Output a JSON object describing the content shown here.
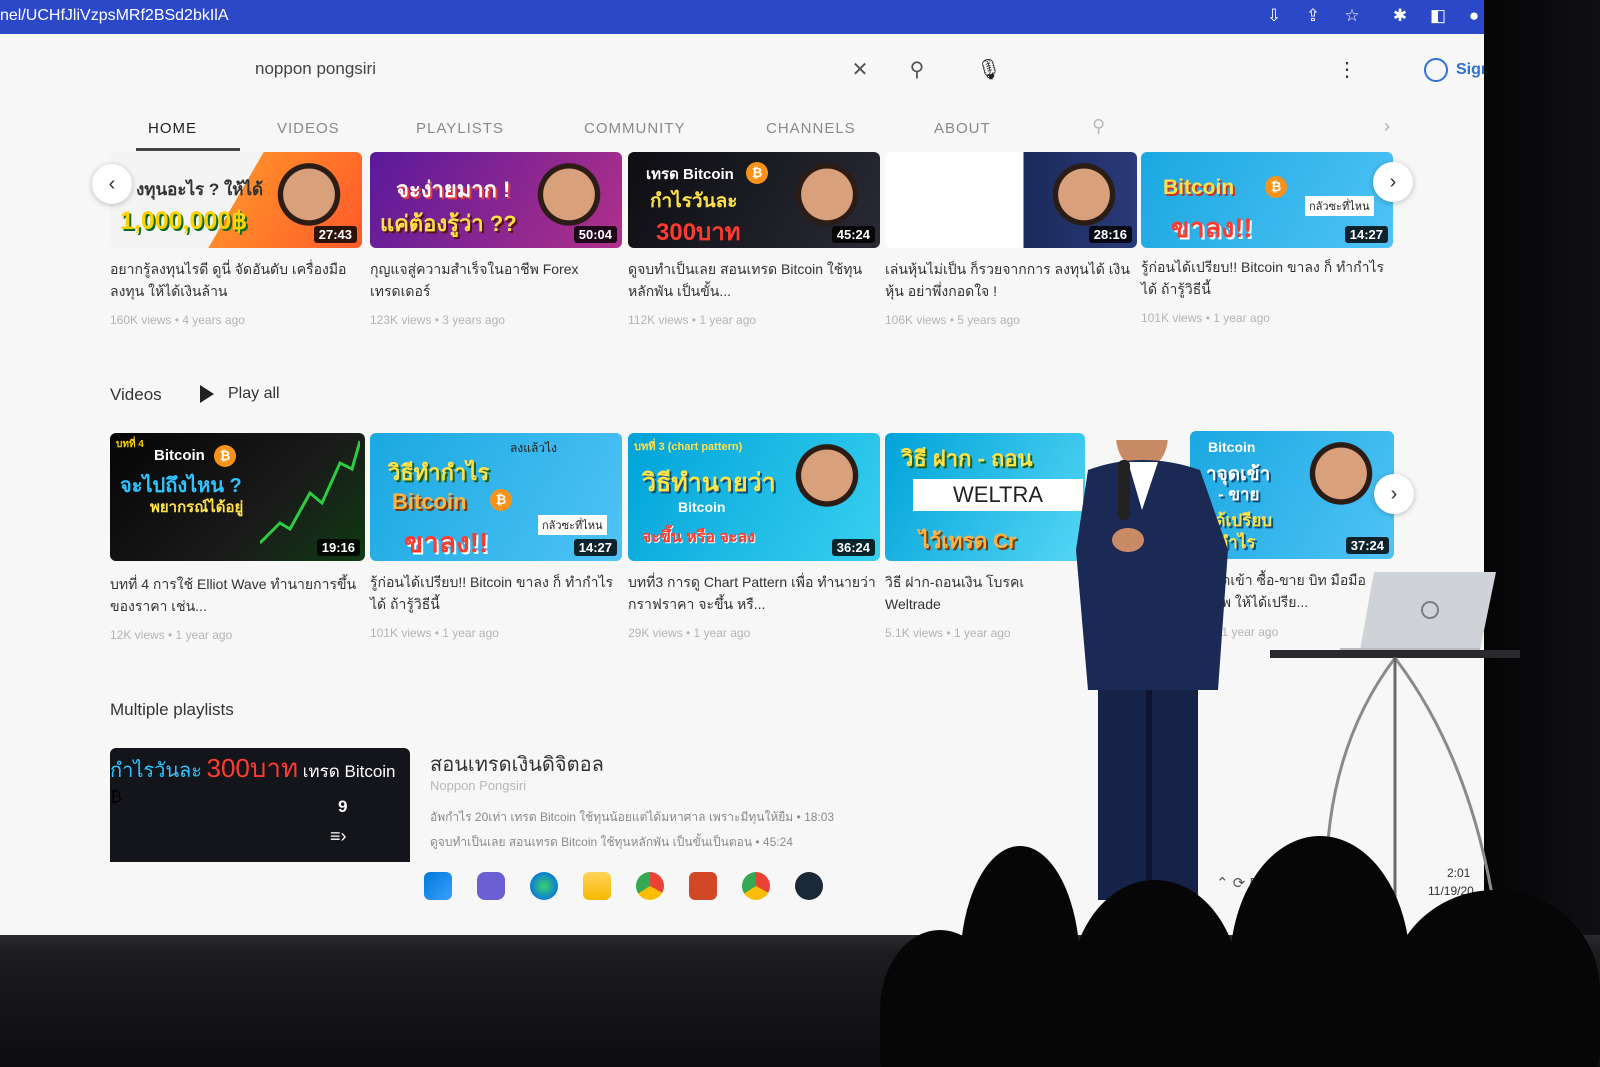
{
  "browser": {
    "url_fragment": "nel/UCHfJliVzpsMRf2BSd2bkIlA",
    "icons": [
      "install-icon",
      "share-icon",
      "star-icon",
      "extensions-icon",
      "window-icon",
      "profile-icon"
    ]
  },
  "channel_header": {
    "search_query": "noppon pongsiri",
    "sign_in_label": "Sign in"
  },
  "tabs": [
    {
      "label": "HOME",
      "active": true
    },
    {
      "label": "VIDEOS"
    },
    {
      "label": "PLAYLISTS"
    },
    {
      "label": "COMMUNITY"
    },
    {
      "label": "CHANNELS"
    },
    {
      "label": "ABOUT"
    }
  ],
  "row1": [
    {
      "thumb_line1": "งทุนอะไร ? ให้ได้",
      "thumb_line2": "1,000,000฿",
      "duration": "27:43",
      "title": "อยากรู้ลงทุนไรดี ดูนี่ จัดอันดับ เครื่องมือลงทุน ให้ได้เงินล้าน",
      "meta": "160K views • 4 years ago"
    },
    {
      "thumb_line1": "จะง่ายมาก !",
      "thumb_line2": "แค่ต้องรู้ว่า ??",
      "duration": "50:04",
      "title": "กุญแจสู่ความสำเร็จในอาชีพ Forex เทรดเดอร์",
      "meta": "123K views • 3 years ago"
    },
    {
      "thumb_line1": "เทรด Bitcoin",
      "thumb_line2": "กำไรวันละ",
      "thumb_line3": "300บาท",
      "duration": "45:24",
      "title": "ดูจบทำเป็นเลย สอนเทรด Bitcoin ใช้ทุนหลักพัน เป็นขั้น...",
      "meta": "112K views • 1 year ago"
    },
    {
      "duration": "28:16",
      "title": "เล่นหุ้นไม่เป็น ก็รวยจากการ ลงทุนได้ เงินหุ้น อย่าพึ่งกอดใจ !",
      "meta": "106K views • 5 years ago"
    },
    {
      "thumb_line1": "Bitcoin",
      "thumb_line2": "ขาลง!!",
      "thumb_tag": "กลัวซะที่ไหน",
      "duration": "14:27",
      "title": "รู้ก่อนได้เปรียบ!! Bitcoin ขาลง ก็ ทำกำไรได้ ถ้ารู้วิธีนี้",
      "meta": "101K views • 1 year ago"
    }
  ],
  "videos_section": {
    "title": "Videos",
    "play_all": "Play all"
  },
  "row2": [
    {
      "thumb_tag": "บทที่ 4",
      "thumb_line1": "Bitcoin",
      "thumb_line2": "จะไปถึงไหน ?",
      "thumb_line3": "พยากรณ์ได้อยู่",
      "duration": "19:16",
      "title": "บทที่ 4 การใช้ Elliot Wave ทำนายการขึ้นของราคา เช่น...",
      "meta": "12K views • 1 year ago"
    },
    {
      "thumb_tag": "ลงแล้วไง",
      "thumb_line1": "วิธีทำกำไร",
      "thumb_line2": "Bitcoin",
      "thumb_line3": "ขาลง!!",
      "thumb_tag2": "กลัวซะที่ไหน",
      "duration": "14:27",
      "title": "รู้ก่อนได้เปรียบ!! Bitcoin ขาลง ก็ ทำกำไรได้ ถ้ารู้วิธีนี้",
      "meta": "101K views • 1 year ago"
    },
    {
      "thumb_tag": "บทที่ 3 (chart pattern)",
      "thumb_line1": "วิธีทำนายว่า",
      "thumb_line2": "Bitcoin",
      "thumb_line3": "จะขึ้น หรือ จะลง",
      "duration": "36:24",
      "title": "บทที่3 การดู Chart Pattern เพื่อ ทำนายว่า กราฟราคา จะขึ้น หรื...",
      "meta": "29K views • 1 year ago"
    },
    {
      "thumb_line1": "วิธี ฝาก - ถอน",
      "thumb_line2": "WELTRA",
      "thumb_line3": "ไว้เทรด Cr",
      "title": "วิธี ฝาก-ถอนเงิน โบรคเ Weltrade",
      "meta": "5.1K views • 1 year ago"
    },
    {
      "thumb_line1": "Bitcoin",
      "thumb_line2": "าจุดเข้า",
      "thumb_line3": "- ขาย",
      "thumb_line4": "ได้เปรียบ",
      "thumb_line5": "กำไร",
      "duration": "37:24",
      "title": "หาจุดเข้า ซื้อ-ขาย บิท มือมืออาชีพ ให้ได้เปรีย...",
      "meta": "ws • 1 year ago"
    }
  ],
  "playlists_section": {
    "title": "Multiple playlists",
    "thumb_line1": "กำไรวันละ",
    "thumb_line2": "300บาท",
    "thumb_line3": "เทรด Bitcoin",
    "count": "9",
    "playlist_title": "สอนเทรดเงินดิจิตอล",
    "channel": "Noppon Pongsiri",
    "items": [
      "อัพกำไร 20เท่า เทรด Bitcoin ใช้ทุนน้อยแต่ได้มหาศาล เพราะมีทุนให้ยืม • 18:03",
      "ดูจบทำเป็นเลย สอนเทรด Bitcoin ใช้ทุนหลักพัน เป็นขั้นเป็นตอน • 45:24"
    ]
  },
  "taskbar": {
    "apps": [
      "windows-start-icon",
      "teams-icon",
      "edge-icon",
      "file-explorer-icon",
      "chrome-icon",
      "powerpoint-icon",
      "chrome-profile-icon",
      "steam-icon"
    ],
    "tray_text": "EN",
    "time": "2:01",
    "date": "11/19/20"
  },
  "colors": {
    "address_bar": "#2a48c8",
    "page_bg": "#f7f7f8",
    "signin_blue": "#2f6fd6",
    "bitcoin_orange": "#f7931a",
    "suit_navy": "#1a2a55"
  }
}
